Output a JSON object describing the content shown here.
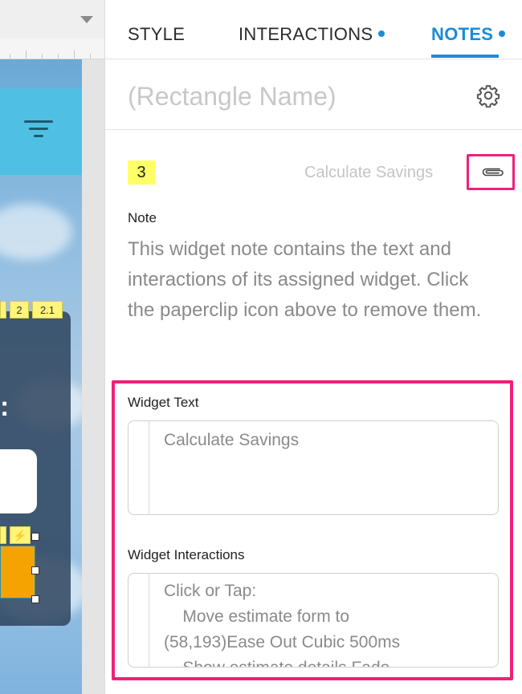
{
  "canvas": {
    "badges": [
      "2",
      "2.1"
    ],
    "lightning_symbol": "⚡",
    "colon_text": ":"
  },
  "panel": {
    "tabs": [
      {
        "label": "STYLE",
        "active": false,
        "has_dot": false
      },
      {
        "label": "INTERACTIONS",
        "active": false,
        "has_dot": true
      },
      {
        "label": "NOTES",
        "active": true,
        "has_dot": true
      }
    ],
    "widget_name_placeholder": "(Rectangle Name)",
    "settings_icon": "gear-icon",
    "note": {
      "number": "3",
      "widget_title": "Calculate Savings",
      "paperclip_icon": "paperclip-icon",
      "label": "Note",
      "body": "This widget note contains the text and interactions of its assigned widget. Click the paperclip icon above to remove them."
    },
    "widget_text": {
      "label": "Widget Text",
      "value": "Calculate Savings"
    },
    "widget_interactions": {
      "label": "Widget Interactions",
      "lines": [
        "Click or Tap:",
        "    Move estimate form to",
        "(58,193)Ease Out Cubic 500ms",
        "    Show estimate details Fade"
      ]
    }
  },
  "colors": {
    "accent_blue": "#1a8cd8",
    "highlight_pink": "#f0207a",
    "note_number_yellow": "#ffff66",
    "header_cyan": "#4fc0e3",
    "button_orange": "#f5a300"
  }
}
